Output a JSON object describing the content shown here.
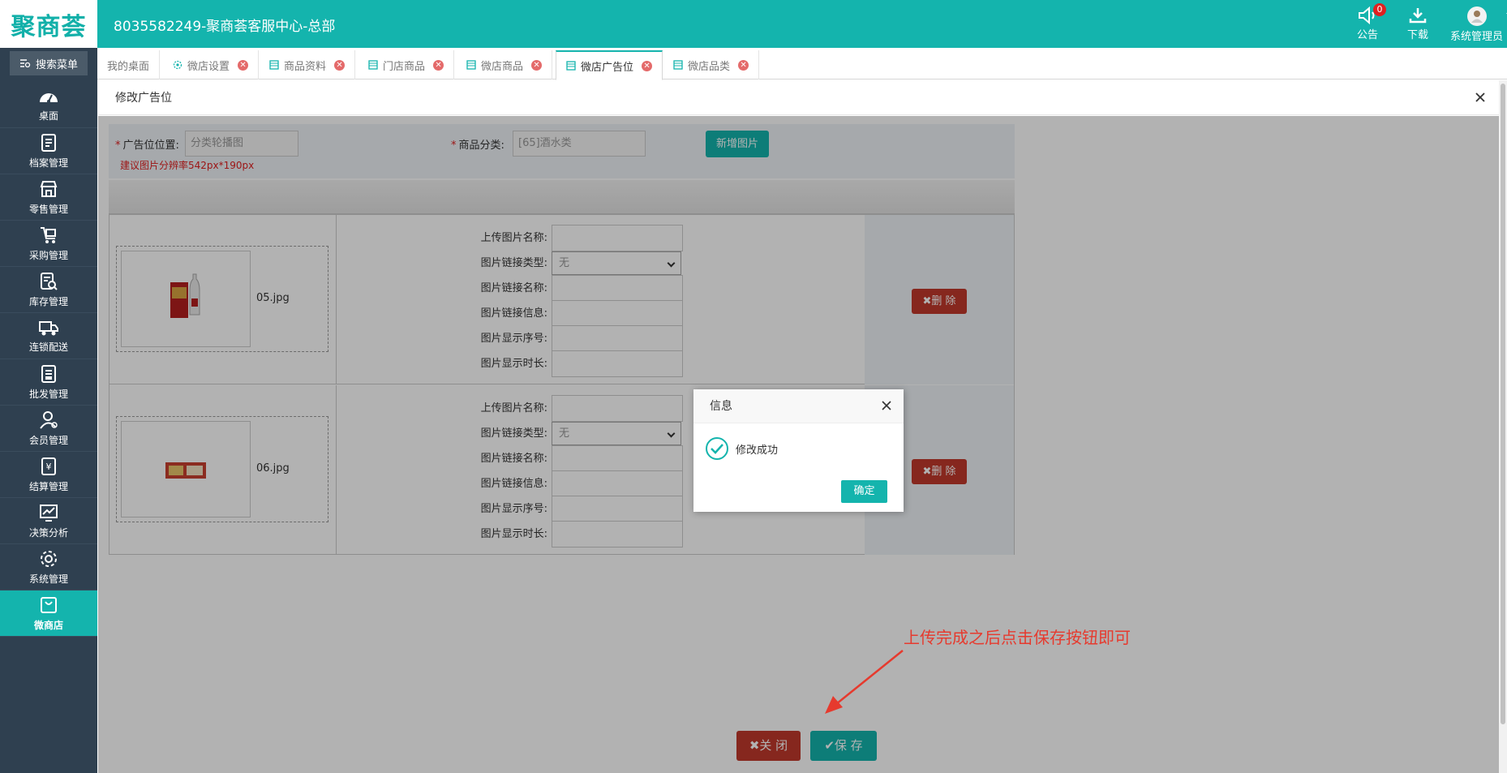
{
  "header": {
    "logo": "聚商荟",
    "title": "8035582249-聚商荟客服中心-总部",
    "notice_label": "公告",
    "notice_count": "0",
    "download_label": "下载",
    "user_label": "系统管理员"
  },
  "sidebar": {
    "search_label": "搜索菜单",
    "items": [
      {
        "label": "桌面",
        "icon": "dashboard-icon"
      },
      {
        "label": "档案管理",
        "icon": "archive-icon"
      },
      {
        "label": "零售管理",
        "icon": "store-icon"
      },
      {
        "label": "采购管理",
        "icon": "cart-icon"
      },
      {
        "label": "库存管理",
        "icon": "inventory-icon"
      },
      {
        "label": "连锁配送",
        "icon": "truck-icon"
      },
      {
        "label": "批发管理",
        "icon": "wholesale-icon"
      },
      {
        "label": "会员管理",
        "icon": "member-icon"
      },
      {
        "label": "结算管理",
        "icon": "settlement-icon"
      },
      {
        "label": "决策分析",
        "icon": "analysis-icon"
      },
      {
        "label": "系统管理",
        "icon": "gear-icon"
      },
      {
        "label": "微商店",
        "icon": "bag-icon"
      }
    ],
    "active_index": 11
  },
  "tabs": [
    {
      "label": "我的桌面"
    },
    {
      "label": "微店设置"
    },
    {
      "label": "商品资料"
    },
    {
      "label": "门店商品"
    },
    {
      "label": "微店商品"
    },
    {
      "label": "微店广告位"
    },
    {
      "label": "微店品类"
    }
  ],
  "panel": {
    "title": "修改广告位",
    "ad_position_label": "广告位位置:",
    "ad_position_value": "分类轮播图",
    "category_label": "商品分类:",
    "category_value": "[65]酒水类",
    "add_image_button": "新增图片",
    "hint": "建议图片分辨率542px*190px",
    "rows": [
      {
        "file_name": "05.jpg",
        "fields": [
          "上传图片名称:",
          "图片链接类型:",
          "图片链接名称:",
          "图片链接信息:",
          "图片显示序号:",
          "图片显示时长:"
        ],
        "link_type": "无",
        "delete_label": "删 除"
      },
      {
        "file_name": "06.jpg",
        "fields": [
          "上传图片名称:",
          "图片链接类型:",
          "图片链接名称:",
          "图片链接信息:",
          "图片显示序号:",
          "图片显示时长:"
        ],
        "link_type": "无",
        "delete_label": "删 除"
      }
    ],
    "close_button": "关 闭",
    "save_button": "保 存"
  },
  "annotation": "上传完成之后点击保存按钮即可",
  "message": {
    "title": "信息",
    "text": "修改成功",
    "ok": "确定"
  }
}
